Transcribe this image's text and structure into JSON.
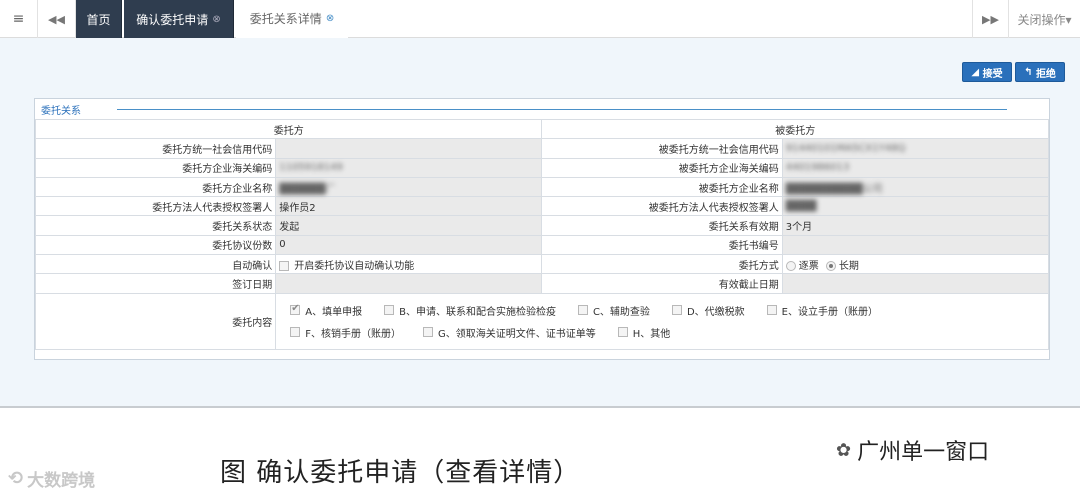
{
  "tabbar": {
    "menu_icon": "≡",
    "prev_icon": "◀◀",
    "tabs": [
      {
        "label": "首页"
      },
      {
        "label": "确认委托申请"
      },
      {
        "label": "委托关系详情"
      }
    ],
    "next_icon": "▶▶",
    "close_ops": "关闭操作▾"
  },
  "toolbar": {
    "accept": "接受",
    "reject": "拒绝"
  },
  "panel": {
    "legend": "委托关系",
    "header_left": "委托方",
    "header_right": "被委托方",
    "rows": [
      {
        "l_label": "委托方统一社会信用代码",
        "l_value": "",
        "r_label": "被委托方统一社会信用代码",
        "r_value": "91440101MA5CX1Y48Q"
      },
      {
        "l_label": "委托方企业海关编码",
        "l_value": "1105918149",
        "r_label": "被委托方企业海关编码",
        "r_value": "4401986013"
      },
      {
        "l_label": "委托方企业名称",
        "l_value": "██████厂",
        "r_label": "被委托方企业名称",
        "r_value": "██████████公司"
      },
      {
        "l_label": "委托方法人代表授权签署人",
        "l_value": "操作员2",
        "r_label": "被委托方法人代表授权签署人",
        "r_value": "████"
      },
      {
        "l_label": "委托关系状态",
        "l_value": "发起",
        "r_label": "委托关系有效期",
        "r_value": "3个月"
      },
      {
        "l_label": "委托协议份数",
        "l_value": "0",
        "r_label": "委托书编号",
        "r_value": ""
      },
      {
        "l_label": "自动确认",
        "l_value": "开启委托协议自动确认功能",
        "r_label": "委托方式",
        "r_value": ""
      },
      {
        "l_label": "签订日期",
        "l_value": "",
        "r_label": "有效截止日期",
        "r_value": ""
      }
    ],
    "method_options": [
      "逐票",
      "长期"
    ],
    "content_label": "委托内容",
    "content_options_line1": [
      "A、填单申报",
      "B、申请、联系和配合实施检验检疫",
      "C、辅助查验",
      "D、代缴税款",
      "E、设立手册（账册）"
    ],
    "content_options_line2": [
      "F、核销手册（账册）",
      "G、领取海关证明文件、证书证单等",
      "H、其他"
    ]
  },
  "caption": "图  确认委托申请（查看详情）",
  "watermark_left": "大数跨境",
  "watermark_right": "广州单一窗口"
}
